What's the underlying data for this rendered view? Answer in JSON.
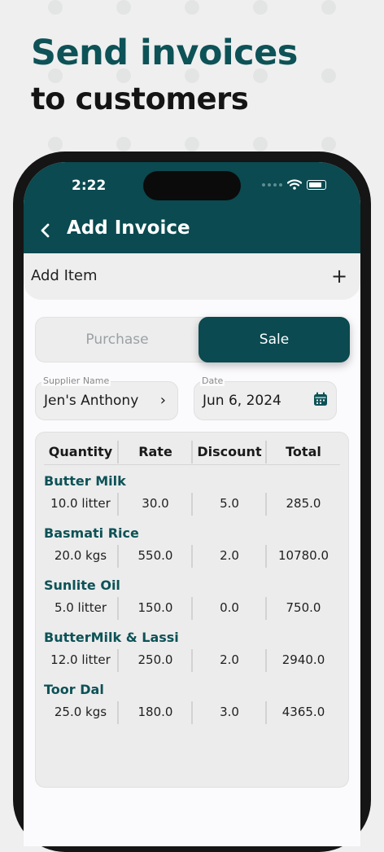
{
  "promo": {
    "line1": "Send invoices",
    "line2": "to customers"
  },
  "status_bar": {
    "time": "2:22"
  },
  "app_bar": {
    "title": "Add Invoice"
  },
  "add_item": {
    "label": "Add Item",
    "plus": "+"
  },
  "segmented": {
    "options": [
      "Purchase",
      "Sale"
    ],
    "selected": "Sale"
  },
  "supplier": {
    "label": "Supplier Name",
    "value": "Jen's Anthony"
  },
  "date": {
    "label": "Date",
    "value": "Jun 6, 2024"
  },
  "table": {
    "headers": [
      "Quantity",
      "Rate",
      "Discount",
      "Total"
    ],
    "items": [
      {
        "name": "Butter Milk",
        "quantity": "10.0 litter",
        "rate": "30.0",
        "discount": "5.0",
        "total": "285.0"
      },
      {
        "name": "Basmati Rice",
        "quantity": "20.0 kgs",
        "rate": "550.0",
        "discount": "2.0",
        "total": "10780.0"
      },
      {
        "name": "Sunlite Oil",
        "quantity": "5.0 litter",
        "rate": "150.0",
        "discount": "0.0",
        "total": "750.0"
      },
      {
        "name": "ButterMilk & Lassi",
        "quantity": "12.0 litter",
        "rate": "250.0",
        "discount": "2.0",
        "total": "2940.0"
      },
      {
        "name": "Toor Dal",
        "quantity": "25.0 kgs",
        "rate": "180.0",
        "discount": "3.0",
        "total": "4365.0"
      }
    ]
  },
  "colors": {
    "brand": "#0a4a50",
    "item_name": "#0d5257",
    "background": "#efefef"
  }
}
